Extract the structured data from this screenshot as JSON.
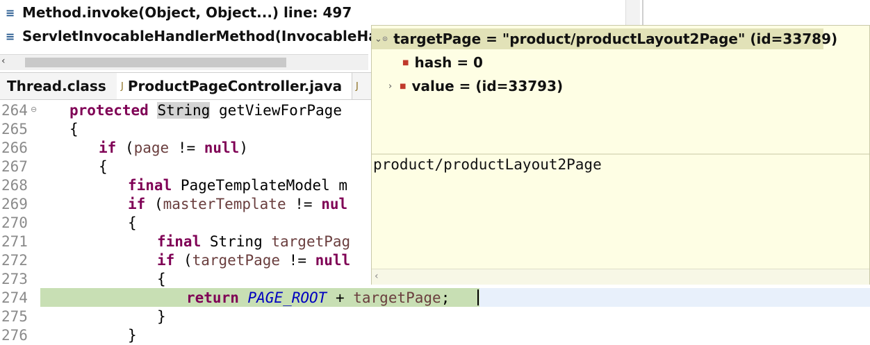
{
  "stack_frames": [
    {
      "label": "Method.invoke(Object, Object...) line: 497"
    },
    {
      "label": "ServletInvocableHandlerMethod(InvocableHan"
    }
  ],
  "tabs": [
    {
      "label": "Thread.class"
    },
    {
      "label": "ProductPageController.java"
    }
  ],
  "line_numbers": [
    "264",
    "265",
    "266",
    "267",
    "268",
    "269",
    "270",
    "271",
    "272",
    "273",
    "274",
    "275",
    "276"
  ],
  "code": {
    "l264_kw": "protected",
    "l264_type": "String",
    "l264_rest": " getViewForPage",
    "l265": "{",
    "l266_kw": "if",
    "l266_a": " (",
    "l266_var": "page",
    "l266_b": " != ",
    "l266_null": "null",
    "l266_c": ")",
    "l267": "{",
    "l268_kw": "final",
    "l268_rest": " PageTemplateModel m",
    "l269_kw": "if",
    "l269_a": " (",
    "l269_var": "masterTemplate",
    "l269_b": " != ",
    "l269_null": "nul",
    "l270": "{",
    "l271_kw": "final",
    "l271_rest": " String ",
    "l271_var": "targetPag",
    "l272_kw": "if",
    "l272_a": " (",
    "l272_var": "targetPage",
    "l272_b": " != ",
    "l272_null": "null",
    "l273": "{",
    "l274_kw": "return",
    "l274_const": "PAGE_ROOT",
    "l274_op": " + ",
    "l274_var": "targetPage",
    "l274_end": ";",
    "l275": "}",
    "l276": "}"
  },
  "popup": {
    "root": {
      "name": "targetPage",
      "value": "= \"product/productLayout2Page\" (id=33789)"
    },
    "children": [
      {
        "name": "hash",
        "value": "= 0"
      },
      {
        "name": "value",
        "value": "= (id=33793)"
      }
    ],
    "detail": "product/productLayout2Page"
  },
  "colors": {
    "keyword": "#7f0055",
    "local_var": "#6a3e3e",
    "constant": "#0000c0",
    "current_line": "#c8dfb4",
    "popup_bg": "#fefee4"
  }
}
